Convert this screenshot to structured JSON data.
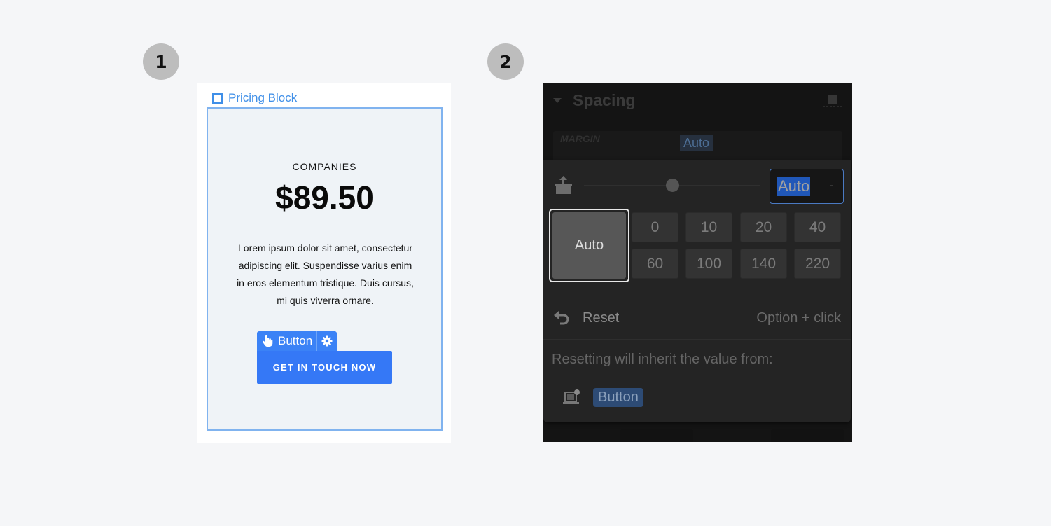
{
  "steps": [
    "1",
    "2"
  ],
  "panel1": {
    "element_label": "Pricing Block",
    "plan_name": "COMPANIES",
    "price": "$89.50",
    "description": "Lorem ipsum dolor sit amet, consectetur adipiscing elit. Suspendisse varius enim in eros elementum tristique. Duis cursus, mi quis viverra ornare.",
    "button_tag": {
      "icon": "hand-pointer-icon",
      "label": "Button",
      "settings_icon": "gear-icon"
    },
    "cta_label": "GET IN TOUCH NOW",
    "colors": {
      "accent": "#3b82f6",
      "selection_border": "#80b3ef",
      "block_bg": "#eff3f7"
    }
  },
  "panel2": {
    "section_title": "Spacing",
    "margin_label": "MARGIN",
    "margin_value": "Auto",
    "popover": {
      "property_icon": "margin-top-icon",
      "slider_position": 0.5,
      "input_value": "Auto",
      "input_unit": "-",
      "auto_button": "Auto",
      "presets": [
        "0",
        "10",
        "20",
        "40",
        "60",
        "100",
        "140",
        "220"
      ],
      "reset_label": "Reset",
      "reset_shortcut": "Option + click",
      "inherit_text": "Resetting will inherit the value from:",
      "inherit_source_icon": "laptop-breakpoint-icon",
      "inherit_source": "Button"
    },
    "colors": {
      "selection": "#2057b8",
      "badge": "#2d4b75"
    }
  }
}
